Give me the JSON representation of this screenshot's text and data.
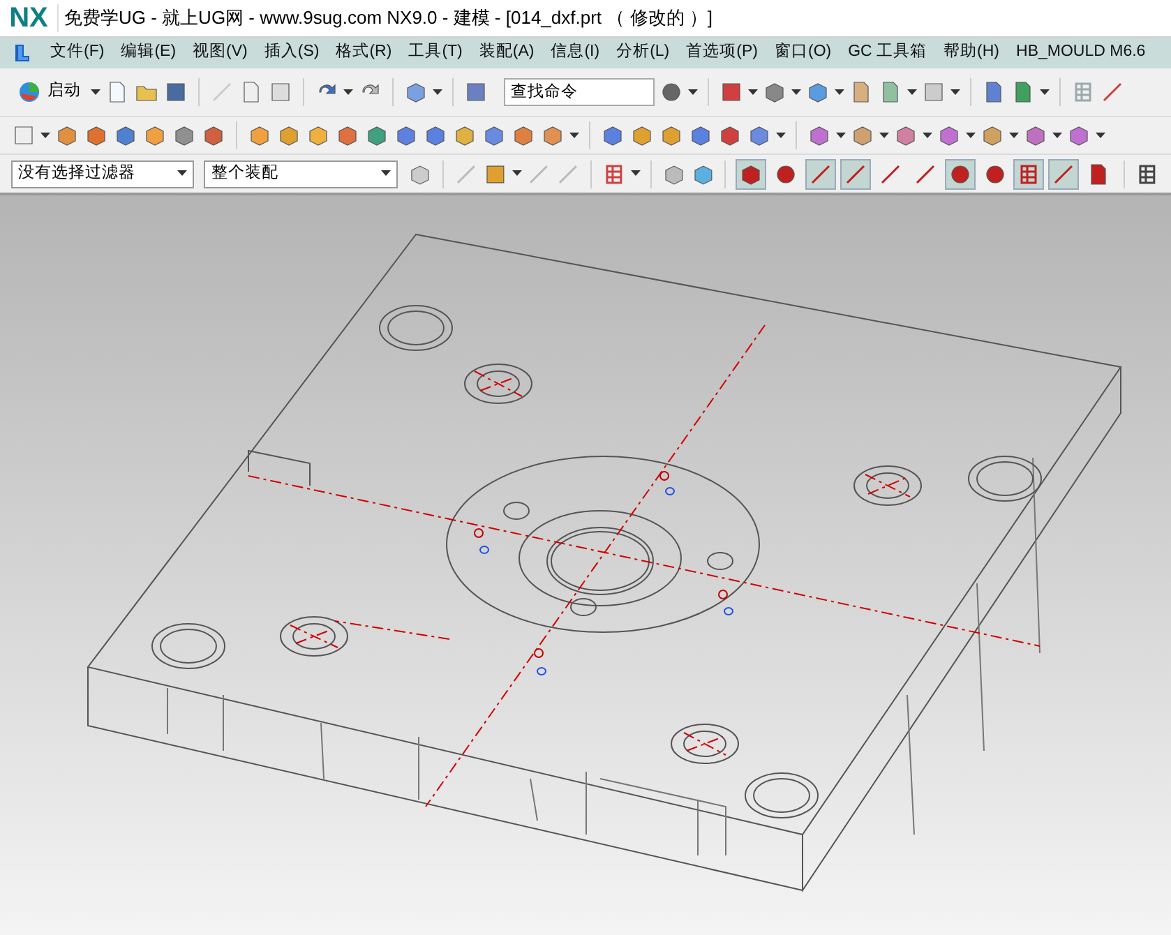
{
  "window": {
    "title": "免费学UG - 就上UG网 - www.9sug.com NX9.0 - 建模 - [014_dxf.prt （ 修改的 ）]",
    "app_logo": "NX"
  },
  "menu": [
    "文件(F)",
    "编辑(E)",
    "视图(V)",
    "插入(S)",
    "格式(R)",
    "工具(T)",
    "装配(A)",
    "信息(I)",
    "分析(L)",
    "首选项(P)",
    "窗口(O)",
    "GC 工具箱",
    "帮助(H)",
    "HB_MOULD M6.6"
  ],
  "standard_toolbar": {
    "start_button": "启动",
    "command_search": {
      "placeholder": "查找命令"
    }
  },
  "selection_bar": {
    "filter": "没有选择过滤器",
    "scope": "整个装配"
  },
  "snap_buttons": [
    {
      "on": true
    },
    {
      "on": false
    },
    {
      "on": true
    },
    {
      "on": true
    },
    {
      "on": false
    },
    {
      "on": false
    },
    {
      "on": true
    },
    {
      "on": false
    },
    {
      "on": true
    },
    {
      "on": true
    },
    {
      "on": false
    }
  ]
}
